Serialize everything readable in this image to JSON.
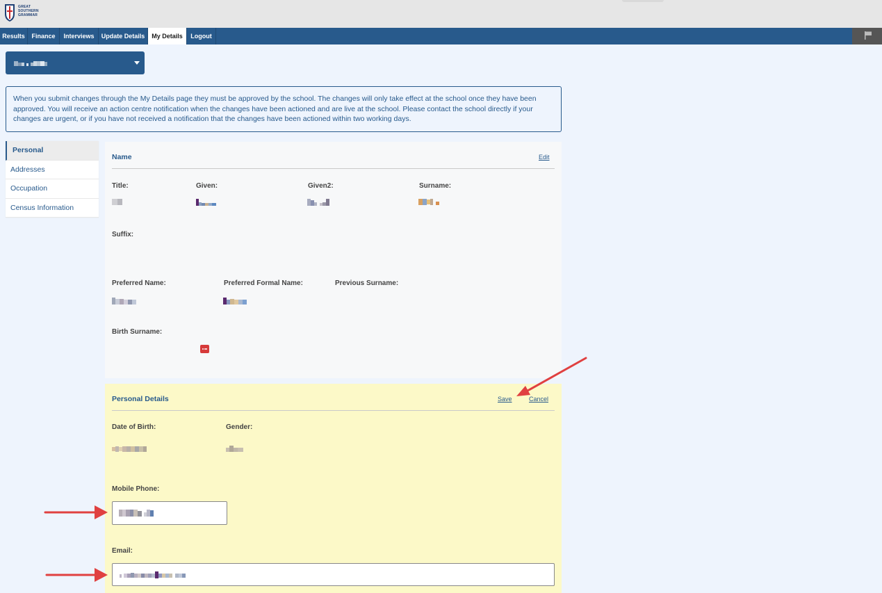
{
  "header": {
    "logo_text": "GREAT SOUTHERN GRAMMAR",
    "tabs": [
      {
        "label": "Results"
      },
      {
        "label": "Finance"
      },
      {
        "label": "Interviews"
      },
      {
        "label": "Update Details"
      },
      {
        "label": "My Details"
      },
      {
        "label": "Logout"
      }
    ],
    "active_tab": "My Details",
    "flag_icon": "flag-icon"
  },
  "notice": {
    "text": "When you submit changes through the My Details page they must be approved by the school. The changes will only take effect at the school once they have been approved. You will receive an action centre notification when the changes have been actioned and are live at the school. Please contact the school directly if your changes are urgent, or if you have not received a notification that the changes have been actioned within two working days."
  },
  "sidebar": {
    "items": [
      {
        "label": "Personal"
      },
      {
        "label": "Addresses"
      },
      {
        "label": "Occupation"
      },
      {
        "label": "Census Information"
      }
    ],
    "active": "Personal"
  },
  "name_card": {
    "title": "Name",
    "edit_label": "Edit",
    "labels": {
      "title": "Title:",
      "given": "Given:",
      "given2": "Given2:",
      "surname": "Surname:",
      "suffix": "Suffix:",
      "preferred_name": "Preferred Name:",
      "preferred_formal_name": "Preferred Formal Name:",
      "previous_surname": "Previous Surname:",
      "birth_surname": "Birth Surname:"
    }
  },
  "personal_card": {
    "title": "Personal Details",
    "save_label": "Save",
    "cancel_label": "Cancel",
    "labels": {
      "date_of_birth": "Date of Birth:",
      "gender": "Gender:",
      "mobile_phone": "Mobile Phone:",
      "email": "Email:"
    }
  },
  "colors": {
    "brand": "#285a8c",
    "edit_background": "#fcf9c8",
    "annotation_arrow": "#e04040"
  }
}
